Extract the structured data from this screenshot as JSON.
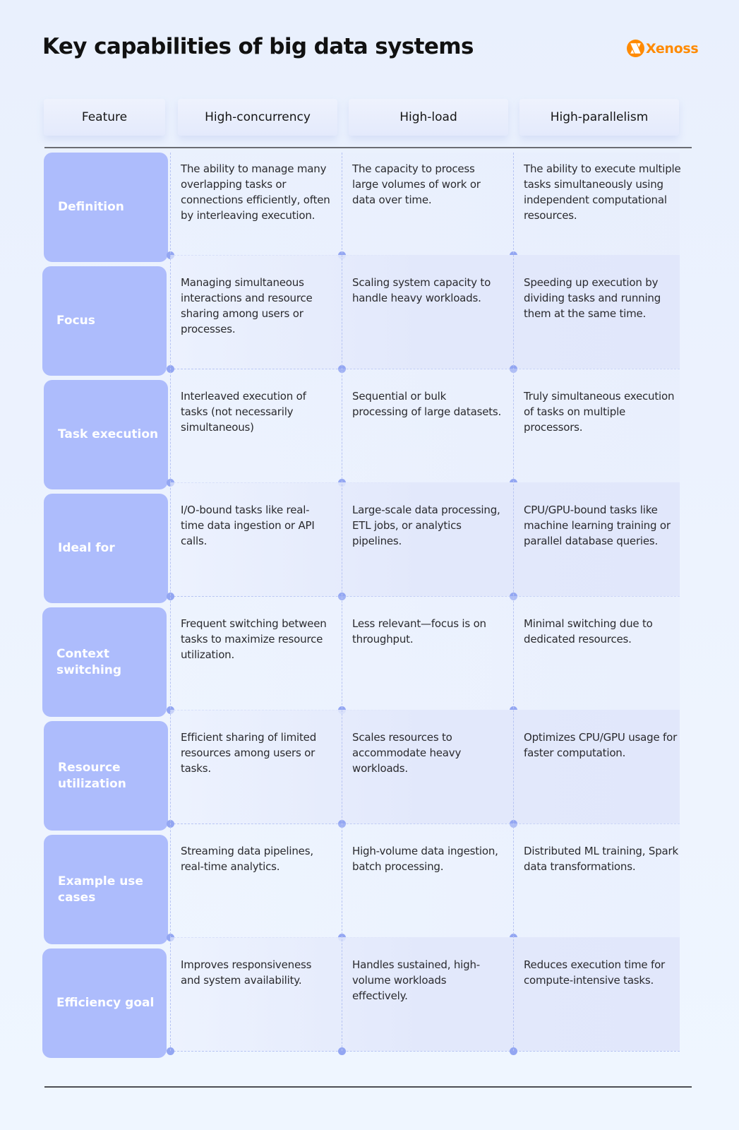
{
  "page": {
    "title": "Key capabilities of big data systems",
    "brand": {
      "name": "Xenoss",
      "icon": "xenoss-logo-icon",
      "color": "#ff8a00"
    }
  },
  "colors": {
    "row_label_bg": "#adbcfc",
    "connector_dot": "#93a6f2",
    "background": "#edf3fe"
  },
  "table": {
    "headers": [
      "Feature",
      "High-concurrency",
      "High-load",
      "High-parallelism"
    ],
    "rows": [
      {
        "feature": "Definition",
        "high_concurrency": "The ability to manage many overlapping tasks or connections efficiently, often by interleaving execution.",
        "high_load": "The capacity to process large volumes of work or data over time.",
        "high_parallelism": "The ability to execute multiple tasks simultaneously using independent computational resources."
      },
      {
        "feature": "Focus",
        "high_concurrency": "Managing simultaneous interactions and resource sharing among users or processes.",
        "high_load": "Scaling system capacity to handle heavy workloads.",
        "high_parallelism": "Speeding up execution by dividing tasks and running them at the same time."
      },
      {
        "feature": "Task execution",
        "high_concurrency": "Interleaved execution of tasks (not necessarily simultaneous)",
        "high_load": "Sequential or bulk processing of large datasets.",
        "high_parallelism": "Truly simultaneous execution of tasks on multiple processors."
      },
      {
        "feature": "Ideal for",
        "high_concurrency": "I/O-bound tasks like real-time data ingestion or API calls.",
        "high_load": "Large-scale data processing, ETL jobs, or analytics pipelines.",
        "high_parallelism": "CPU/GPU-bound tasks like machine learning training or parallel database queries."
      },
      {
        "feature": "Context switching",
        "high_concurrency": "Frequent switching between tasks to maximize resource utilization.",
        "high_load": "Less relevant—focus is on throughput.",
        "high_parallelism": "Minimal switching due to dedicated resources."
      },
      {
        "feature": "Resource utilization",
        "high_concurrency": "Efficient sharing of limited resources among users or tasks.",
        "high_load": "Scales resources to accommodate heavy workloads.",
        "high_parallelism": "Optimizes CPU/GPU usage for faster computation."
      },
      {
        "feature": "Example use cases",
        "high_concurrency": "Streaming data pipelines, real-time analytics.",
        "high_load": "High-volume data ingestion, batch processing.",
        "high_parallelism": "Distributed ML training, Spark data transformations."
      },
      {
        "feature": "Efficiency goal",
        "high_concurrency": "Improves responsiveness and system availability.",
        "high_load": "Handles sustained, high-volume workloads effectively.",
        "high_parallelism": "Reduces execution time for compute-intensive tasks."
      }
    ]
  }
}
